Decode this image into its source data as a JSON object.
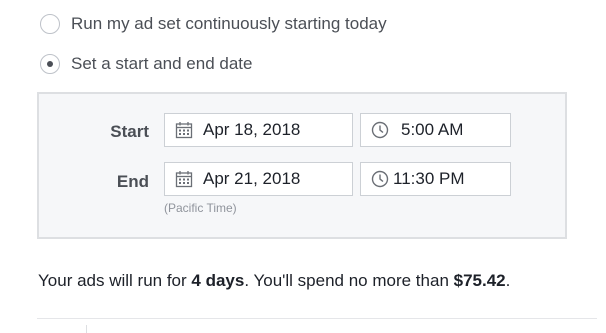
{
  "schedule_options": [
    {
      "label": "Run my ad set continuously starting today",
      "selected": false
    },
    {
      "label": "Set a start and end date",
      "selected": true
    }
  ],
  "date_range": {
    "start": {
      "label": "Start",
      "date": "Apr 18, 2018",
      "time": "5:00 AM"
    },
    "end": {
      "label": "End",
      "date": "Apr 21, 2018",
      "time": "11:30 PM"
    },
    "timezone_note": "(Pacific Time)"
  },
  "summary": {
    "prefix": "Your ads will run for ",
    "duration": "4 days",
    "middle": ". You'll spend no more than ",
    "amount": "$75.42",
    "suffix": "."
  },
  "icons": {
    "date": "calendar-icon",
    "time": "clock-icon"
  },
  "colors": {
    "panel_bg": "#f6f7f9",
    "panel_border": "#dddfe2",
    "text": "#1d2129",
    "muted": "#90949c"
  }
}
